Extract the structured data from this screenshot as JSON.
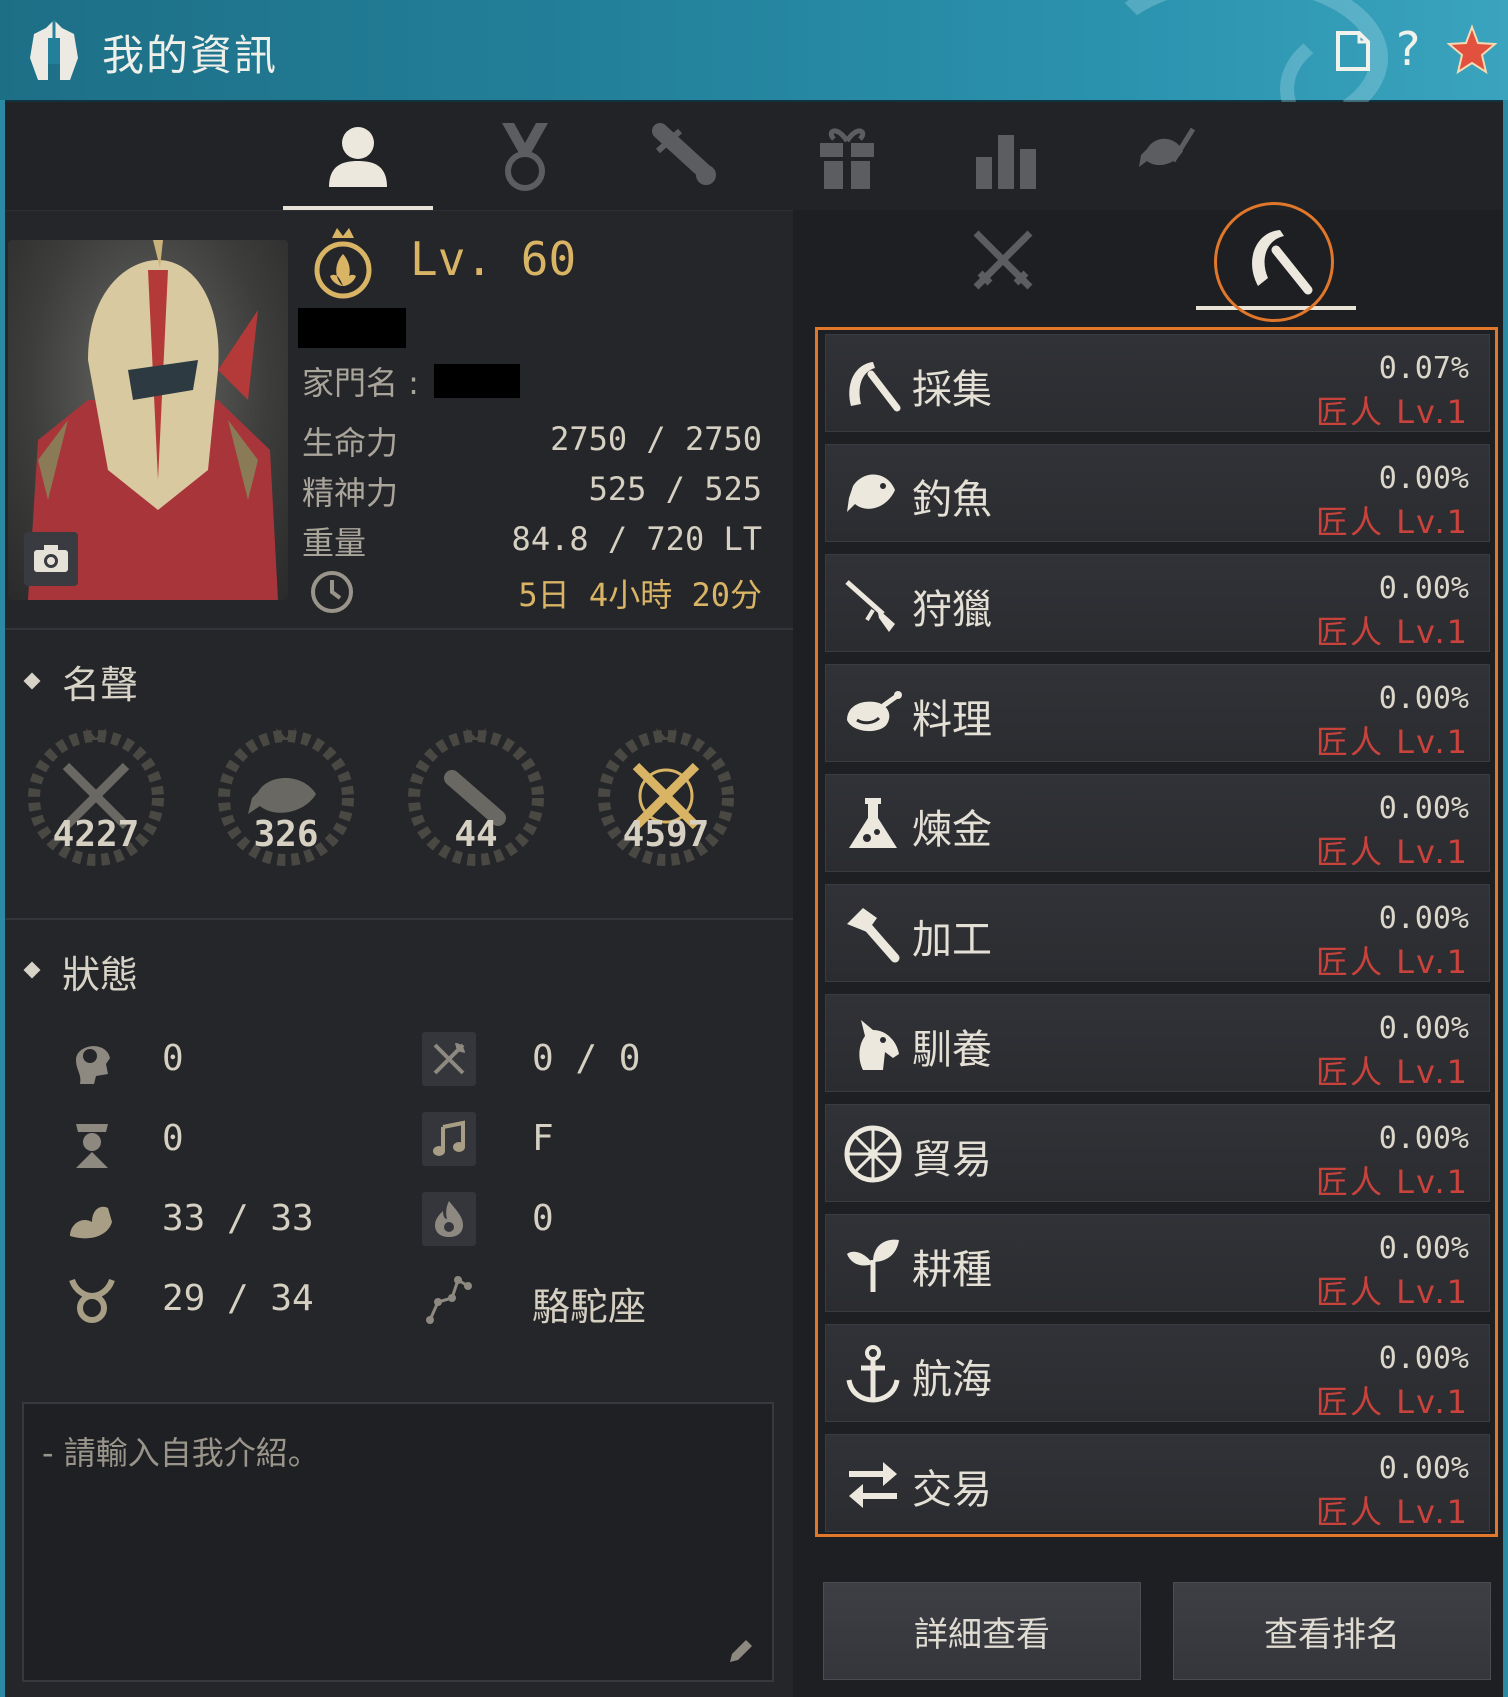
{
  "window": {
    "title": "我的資訊",
    "title_icon": "helmet-icon",
    "controls": [
      "document-icon",
      "help-icon",
      "star-icon"
    ],
    "help_label": "?"
  },
  "tabs": [
    {
      "icon": "profile-icon",
      "active": true
    },
    {
      "icon": "medal-icon",
      "active": false
    },
    {
      "icon": "scroll-icon",
      "active": false
    },
    {
      "icon": "gift-icon",
      "active": false
    },
    {
      "icon": "bar-chart-icon",
      "active": false
    },
    {
      "icon": "fish-harpoon-icon",
      "active": false
    }
  ],
  "character": {
    "level": "Lv. 60",
    "family_label": "家門名 :",
    "stats": [
      {
        "label": "生命力",
        "value": "2750 / 2750"
      },
      {
        "label": "精神力",
        "value": "525 / 525"
      },
      {
        "label": "重量",
        "value": "84.8 / 720 LT"
      }
    ],
    "playtime": "5日 4小時 20分"
  },
  "reputation": {
    "title": "名聲",
    "items": [
      {
        "icon": "crossed-swords-icon",
        "value": "4227"
      },
      {
        "icon": "fish-icon",
        "value": "326"
      },
      {
        "icon": "scroll-icon",
        "value": "44"
      },
      {
        "icon": "crossed-swords-gold-icon",
        "value": "4597"
      }
    ]
  },
  "status": {
    "title": "狀態",
    "left": [
      {
        "icon": "mind-head-icon",
        "value": "0"
      },
      {
        "icon": "officer-icon",
        "value": "0"
      },
      {
        "icon": "strength-arm-icon",
        "value": "33 / 33"
      },
      {
        "icon": "taurus-icon",
        "value": "29 / 34"
      }
    ],
    "right": [
      {
        "icon": "axe-crossed-icon",
        "value": "0 / 0"
      },
      {
        "icon": "music-note-icon",
        "value": "F"
      },
      {
        "icon": "flame-icon",
        "value": "0"
      },
      {
        "icon": "constellation-icon",
        "value": "駱駝座"
      }
    ]
  },
  "intro": {
    "placeholder": "- 請輸入自我介紹。"
  },
  "subtabs": [
    {
      "icon": "combat-swords-icon",
      "active": false
    },
    {
      "icon": "sickle-icon",
      "active": true
    }
  ],
  "life_skills": [
    {
      "icon": "sickle-icon",
      "name": "採集",
      "percent": "0.07%",
      "rank": "匠人 Lv.1"
    },
    {
      "icon": "fish-icon",
      "name": "釣魚",
      "percent": "0.00%",
      "rank": "匠人 Lv.1"
    },
    {
      "icon": "rifle-icon",
      "name": "狩獵",
      "percent": "0.00%",
      "rank": "匠人 Lv.1"
    },
    {
      "icon": "cooking-chicken-icon",
      "name": "料理",
      "percent": "0.00%",
      "rank": "匠人 Lv.1"
    },
    {
      "icon": "flask-icon",
      "name": "煉金",
      "percent": "0.00%",
      "rank": "匠人 Lv.1"
    },
    {
      "icon": "hammer-icon",
      "name": "加工",
      "percent": "0.00%",
      "rank": "匠人 Lv.1"
    },
    {
      "icon": "horse-head-icon",
      "name": "馴養",
      "percent": "0.00%",
      "rank": "匠人 Lv.1"
    },
    {
      "icon": "wheel-icon",
      "name": "貿易",
      "percent": "0.00%",
      "rank": "匠人 Lv.1"
    },
    {
      "icon": "sprout-icon",
      "name": "耕種",
      "percent": "0.00%",
      "rank": "匠人 Lv.1"
    },
    {
      "icon": "anchor-icon",
      "name": "航海",
      "percent": "0.00%",
      "rank": "匠人 Lv.1"
    },
    {
      "icon": "exchange-arrows-icon",
      "name": "交易",
      "percent": "0.00%",
      "rank": "匠人 Lv.1"
    }
  ],
  "buttons": {
    "details": "詳細查看",
    "ranking": "查看排名"
  },
  "colors": {
    "title_bar": "#23809a",
    "panel_bg": "#25262a",
    "gold_accent": "#d9b465",
    "rank_red": "#c9433c",
    "highlight_orange": "#e0772a"
  }
}
